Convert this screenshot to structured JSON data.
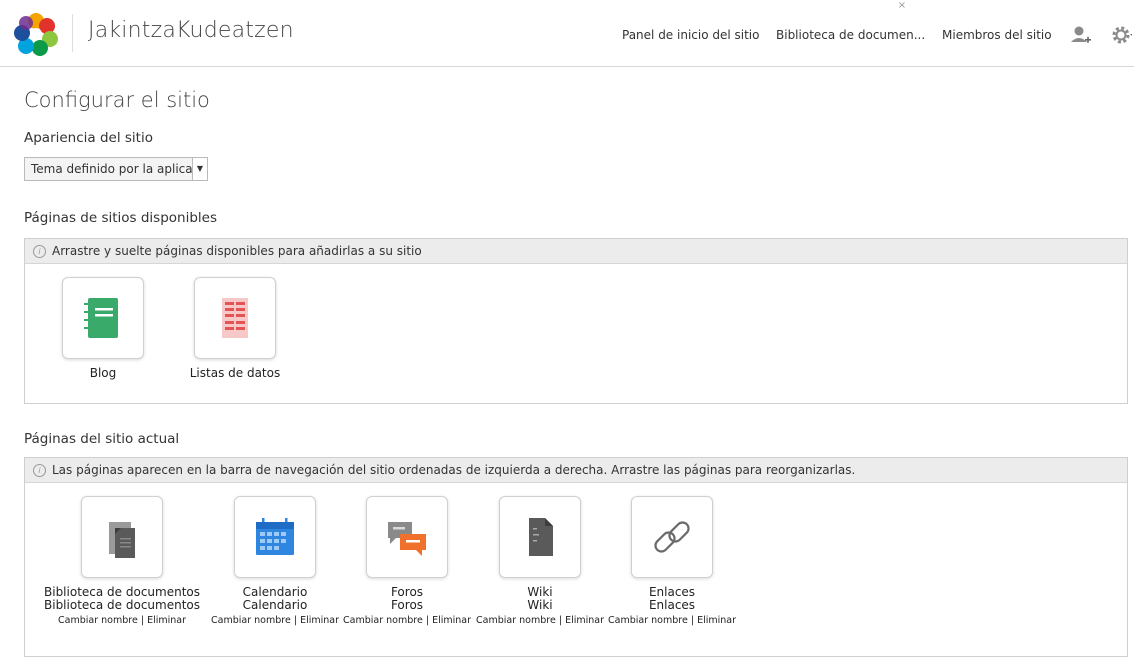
{
  "header": {
    "site_title": "JakintzaKudeatzen",
    "nav": [
      "Panel de inicio del sitio",
      "Biblioteca de documen...",
      "Miembros del sitio"
    ],
    "close_glyph": "×",
    "icons": [
      "add-user-icon",
      "gear-icon"
    ]
  },
  "page": {
    "title": "Configurar el sitio"
  },
  "appearance": {
    "label": "Apariencia del sitio",
    "selected": "Tema definido por la aplica"
  },
  "available": {
    "label": "Páginas de sitios disponibles",
    "hint": "Arrastre y suelte páginas disponibles para añadirlas a su sitio",
    "pages": [
      {
        "label": "Blog",
        "icon": "blog-icon"
      },
      {
        "label": "Listas de datos",
        "icon": "data-lists-icon"
      }
    ]
  },
  "current": {
    "label": "Páginas del sitio actual",
    "hint": "Las páginas aparecen en la barra de navegación del sitio ordenadas de izquierda a derecha. Arrastre las páginas para reorganizarlas.",
    "rename": "Cambiar nombre",
    "separator": "|",
    "remove": "Eliminar",
    "pages": [
      {
        "title": "Biblioteca de documentos",
        "subtitle": "Biblioteca de documentos",
        "icon": "document-library-icon"
      },
      {
        "title": "Calendario",
        "subtitle": "Calendario",
        "icon": "calendar-icon"
      },
      {
        "title": "Foros",
        "subtitle": "Foros",
        "icon": "forums-icon"
      },
      {
        "title": "Wiki",
        "subtitle": "Wiki",
        "icon": "wiki-icon"
      },
      {
        "title": "Enlaces",
        "subtitle": "Enlaces",
        "icon": "links-icon"
      }
    ]
  }
}
